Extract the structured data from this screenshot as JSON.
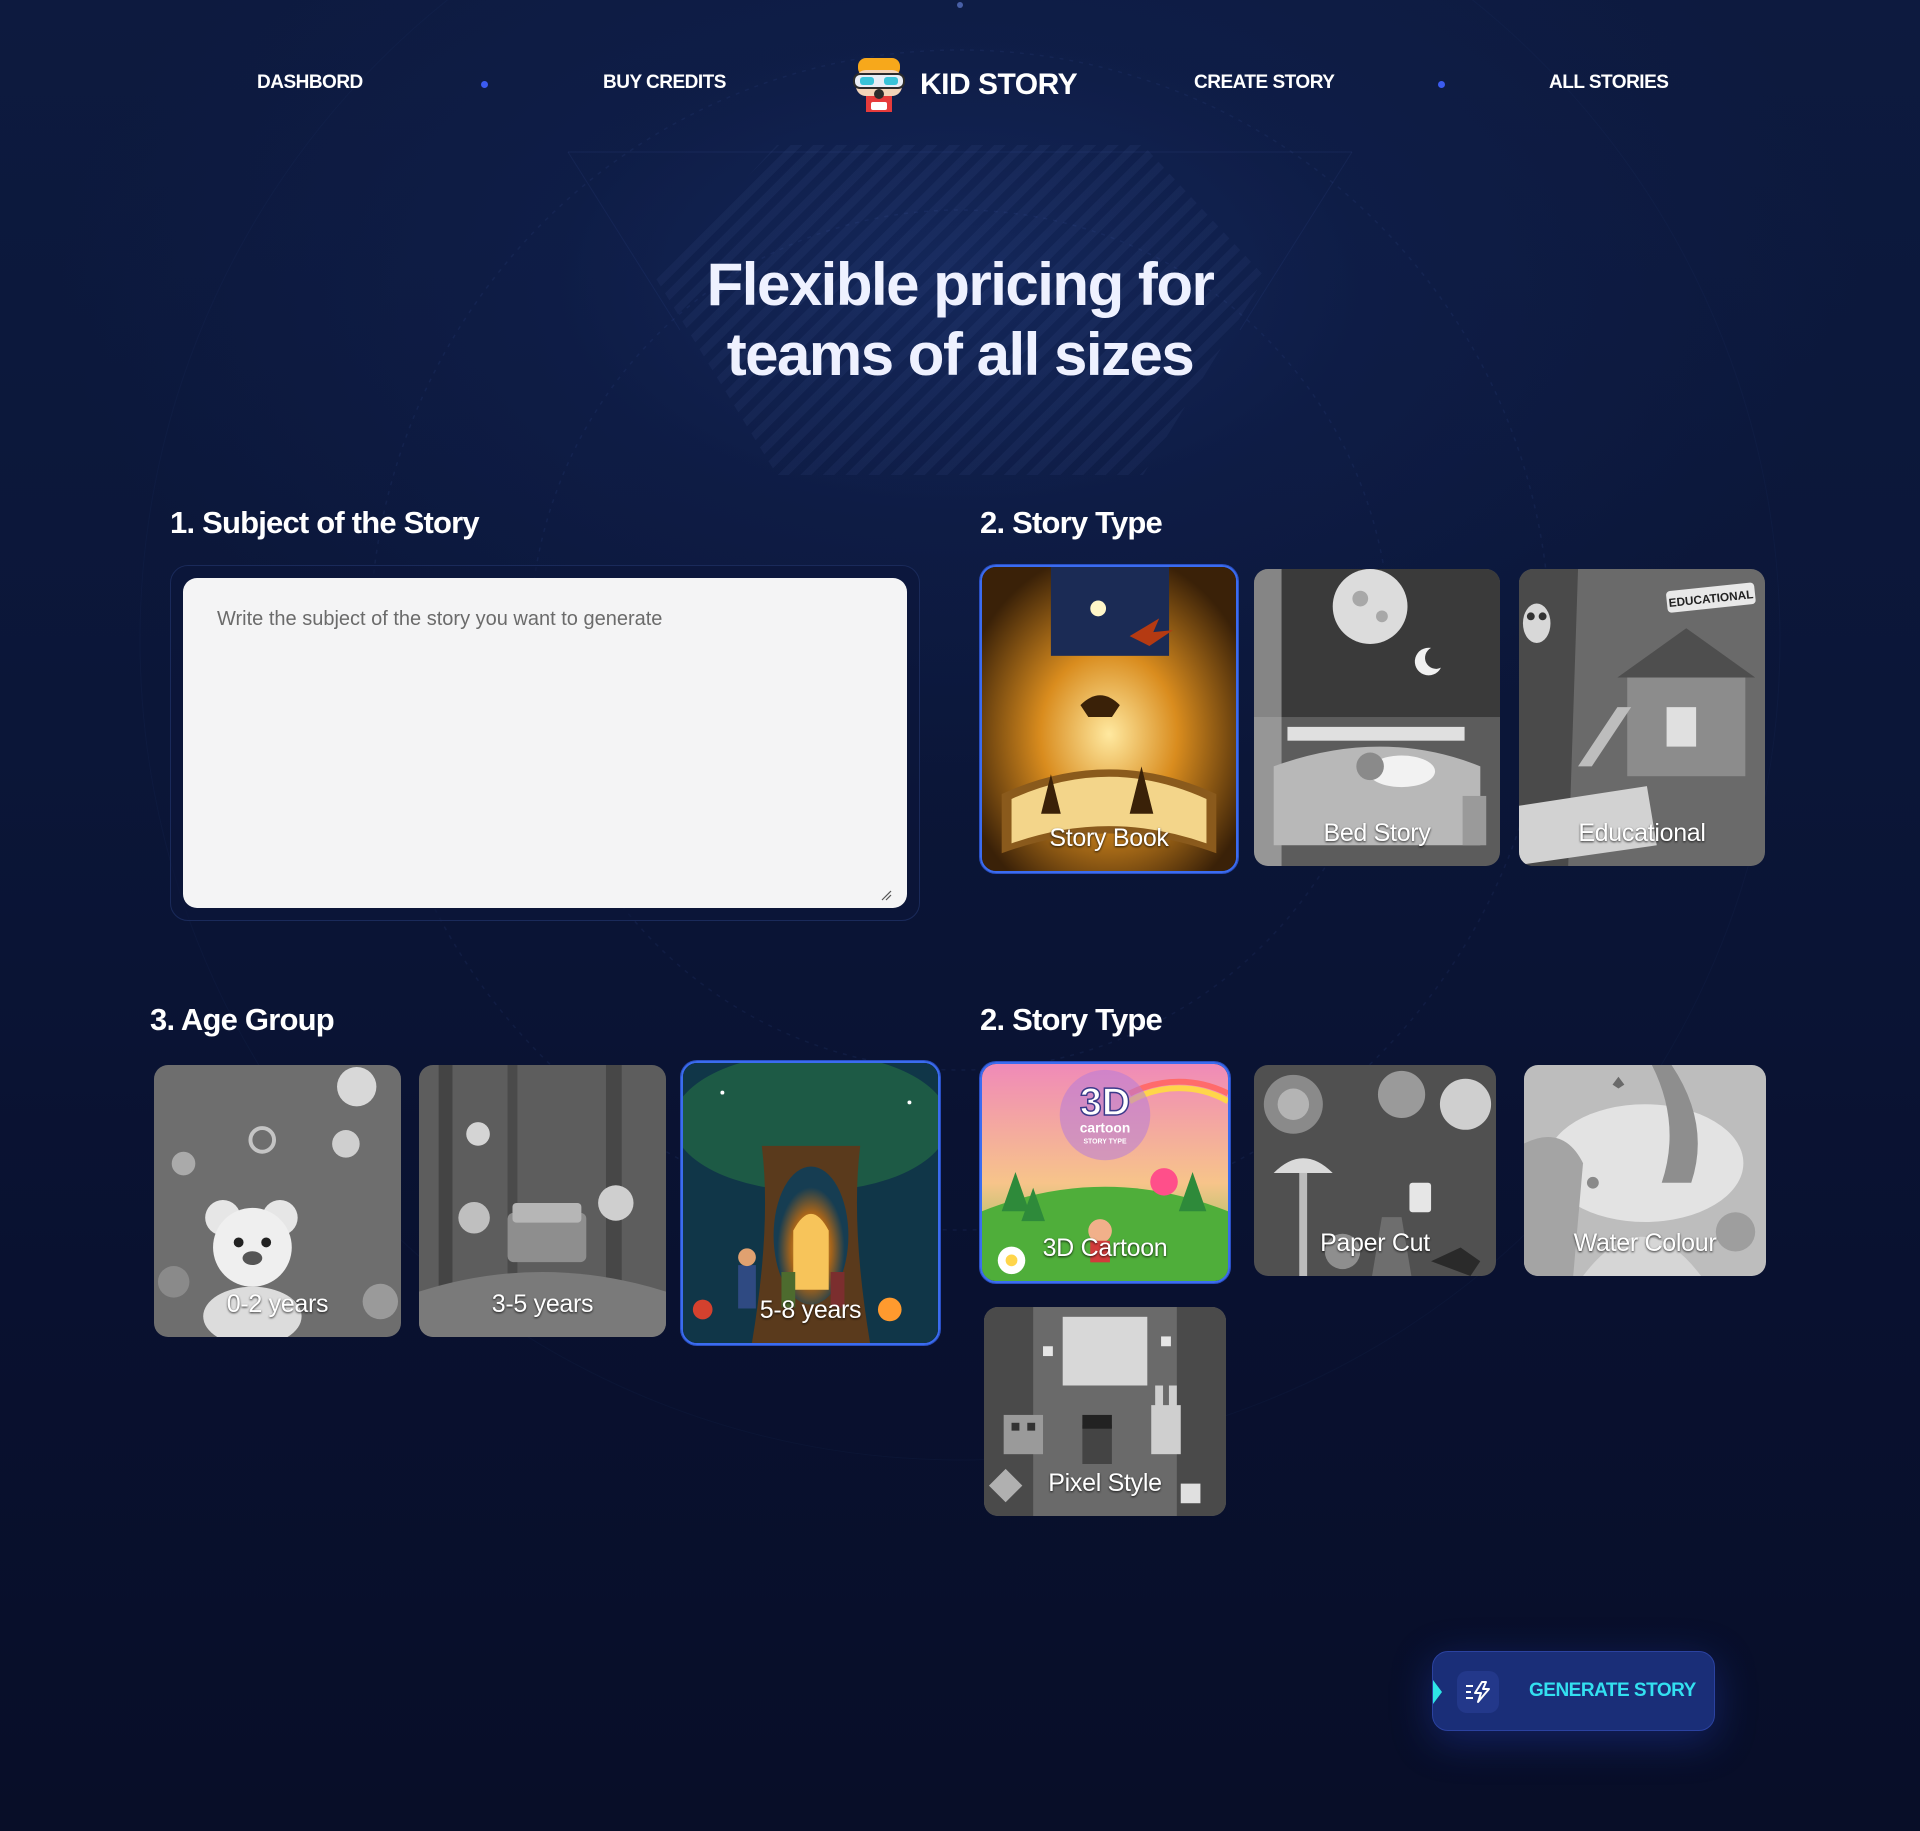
{
  "nav": {
    "dashboard": "DASHBORD",
    "buy_credits": "BUY CREDITS",
    "logo_text": "KID STORY",
    "create_story": "CREATE STORY",
    "all_stories": "ALL STORIES"
  },
  "hero": {
    "title_line1": "Flexible pricing for",
    "title_line2": "teams of all sizes"
  },
  "subject": {
    "title": "1. Subject of the Story",
    "placeholder": "Write the subject of the story you want to generate"
  },
  "story_type": {
    "title": "2. Story Type",
    "options": [
      {
        "label": "Story Book",
        "selected": true
      },
      {
        "label": "Bed Story",
        "selected": false
      },
      {
        "label": "Educational",
        "selected": false,
        "badge": "EDUCATIONAL"
      }
    ]
  },
  "age_group": {
    "title": "3. Age Group",
    "options": [
      {
        "label": "0-2 years",
        "selected": false
      },
      {
        "label": "3-5 years",
        "selected": false
      },
      {
        "label": "5-8 years",
        "selected": true
      }
    ]
  },
  "art_style": {
    "title": "2. Story Type",
    "options": [
      {
        "label": "3D Cartoon",
        "selected": true,
        "badge_big": "3D",
        "badge_mid": "cartoon",
        "badge_small": "STORY TYPE"
      },
      {
        "label": "Paper Cut",
        "selected": false
      },
      {
        "label": "Water Colour",
        "selected": false
      },
      {
        "label": "Pixel Style",
        "selected": false
      }
    ]
  },
  "generate": {
    "label": "GENERATE STORY"
  },
  "colors": {
    "accent": "#3b6cf0",
    "button_bg": "#1a2e78",
    "button_text": "#33e0f0"
  }
}
